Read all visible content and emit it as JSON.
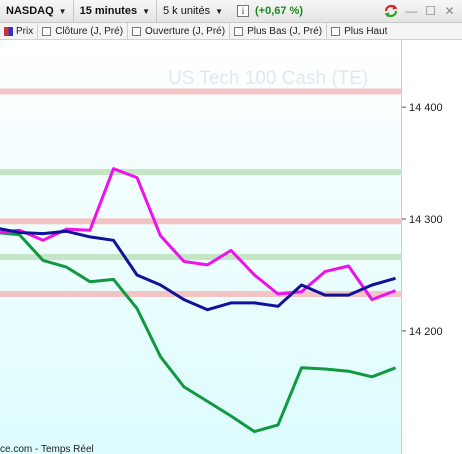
{
  "toolbar": {
    "instrument": "NASDAQ",
    "interval": "15 minutes",
    "units": "5 k unités",
    "info_icon": "i",
    "change": "(+0,67 %)"
  },
  "legend": {
    "items": [
      "Prix",
      "Clôture (J, Pré)",
      "Ouverture (J, Pré)",
      "Plus Bas (J, Pré)",
      "Plus Haut"
    ]
  },
  "watermark": "US Tech 100 Cash (TE)",
  "source": "ce.com - Temps Réel",
  "colors": {
    "price": "#11119a",
    "magenta": "#ee11ee",
    "green": "#119940",
    "band_red": "#f4c4c4",
    "band_green": "#c4e6c4",
    "bg_top": "#ffffff",
    "bg_bottom": "#dcfcfe"
  },
  "chart_data": {
    "type": "line",
    "yticks": [
      "14 400",
      "14 300",
      "14 200"
    ],
    "ytick_values": [
      14400,
      14300,
      14200
    ],
    "ylim": [
      14090,
      14460
    ],
    "x": [
      0,
      1,
      2,
      3,
      4,
      5,
      6,
      7,
      8,
      9,
      10,
      11,
      12,
      13,
      14,
      15,
      16,
      17,
      18,
      19,
      20
    ],
    "series": [
      {
        "key": "blue",
        "color": "#11119a",
        "values": [
          14292,
          14288,
          14287,
          14289,
          14284,
          14281,
          14250,
          14241,
          14228,
          14219,
          14225,
          14225,
          14222,
          14241,
          14232,
          14232,
          14241,
          14247
        ]
      },
      {
        "key": "magenta",
        "color": "#ee11ee",
        "values": [
          14288,
          14290,
          14281,
          14291,
          14290,
          14345,
          14337,
          14285,
          14262,
          14259,
          14272,
          14250,
          14233,
          14235,
          14253,
          14258,
          14228,
          14236
        ]
      },
      {
        "key": "green",
        "color": "#119940",
        "values": [
          14288,
          14286,
          14263,
          14257,
          14244,
          14246,
          14220,
          14177,
          14150,
          14137,
          14124,
          14110,
          14116,
          14167,
          14166,
          14164,
          14159,
          14167
        ]
      }
    ],
    "bands": [
      {
        "value": 14414,
        "kind": "red"
      },
      {
        "value": 14342,
        "kind": "green"
      },
      {
        "value": 14298,
        "kind": "red"
      },
      {
        "value": 14266,
        "kind": "green"
      },
      {
        "value": 14233,
        "kind": "red"
      }
    ]
  }
}
